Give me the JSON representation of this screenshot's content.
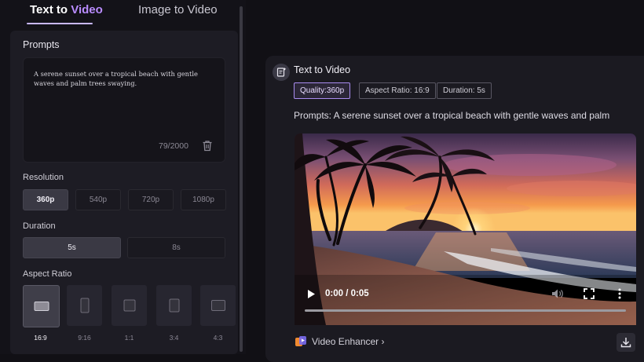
{
  "tabs": {
    "text_to_video_main": "Text to ",
    "text_to_video_accent": "Video",
    "image_to_video": "Image to Video"
  },
  "form": {
    "prompts_label": "Prompts",
    "prompt_value": "A serene sunset over a tropical beach with gentle waves and palm trees swaying.",
    "prompt_count": "79/2000",
    "resolution_label": "Resolution",
    "resolutions": [
      "360p",
      "540p",
      "720p",
      "1080p"
    ],
    "resolution_selected": "360p",
    "duration_label": "Duration",
    "durations": [
      "5s",
      "8s"
    ],
    "duration_selected": "5s",
    "aspect_label": "Aspect Ratio",
    "aspect_ratios": [
      "16:9",
      "9:16",
      "1:1",
      "3:4",
      "4:3"
    ],
    "aspect_selected": "16:9"
  },
  "result": {
    "title": "Text to Video",
    "tag_quality": "Quality:360p",
    "tag_aspect": "Aspect Ratio: 16:9",
    "tag_duration": "Duration: 5s",
    "prompt_line": "Prompts:  A serene sunset over a tropical beach with gentle waves and palm",
    "video_time": "0:00 / 0:05",
    "video_progress": 0,
    "enhancer_label": "Video Enhancer ›"
  },
  "icons": {
    "trash": "trash-icon",
    "result": "document-sparkle-icon",
    "play": "play-icon",
    "volume": "volume-icon",
    "fullscreen": "fullscreen-icon",
    "more": "more-vertical-icon",
    "enhancer": "video-enhancer-icon",
    "download": "download-icon"
  },
  "colors": {
    "accent": "#b98cff",
    "quality_tag_border": "#a98cf0",
    "background": "#111015",
    "panel": "#1d1c24"
  }
}
